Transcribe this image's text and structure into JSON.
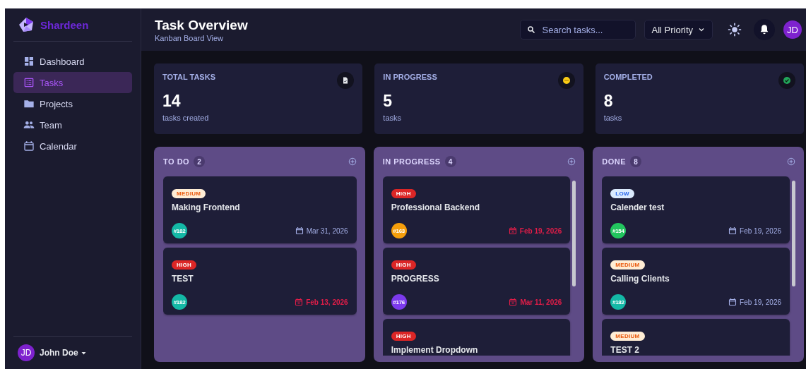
{
  "sidebar": {
    "brand": "Shardeen",
    "items": [
      {
        "label": "Dashboard",
        "selected": false
      },
      {
        "label": "Tasks",
        "selected": true
      },
      {
        "label": "Projects",
        "selected": false
      },
      {
        "label": "Team",
        "selected": false
      },
      {
        "label": "Calendar",
        "selected": false
      }
    ],
    "user": {
      "initials": "JD",
      "name": "John Doe"
    }
  },
  "header": {
    "title": "Task Overview",
    "subtitle": "Kanban Board View",
    "search": {
      "placeholder": "Search tasks..."
    },
    "filter": "All Priority",
    "avatar": "JD"
  },
  "stats": [
    {
      "kind": "total",
      "label": "TOTAL TASKS",
      "value": "14",
      "caption": "tasks created"
    },
    {
      "kind": "progress",
      "label": "IN PROGRESS",
      "value": "5",
      "caption": "tasks"
    },
    {
      "kind": "completed",
      "label": "COMPLETED",
      "value": "8",
      "caption": "tasks"
    }
  ],
  "columns": [
    {
      "title": "TO DO",
      "count": "2",
      "cards": [
        {
          "priority": "MEDIUM",
          "kind": "medium",
          "title": "Making Frontend",
          "id": "#182",
          "color": "#14b8a6",
          "date": "Mar 31, 2026",
          "overdue": false
        },
        {
          "priority": "HIGH",
          "kind": "high",
          "title": "TEST",
          "id": "#182",
          "color": "#14b8a6",
          "date": "Feb 13, 2026",
          "overdue": true
        }
      ]
    },
    {
      "title": "IN PROGRESS",
      "count": "4",
      "cards": [
        {
          "priority": "HIGH",
          "kind": "high",
          "title": "Professional Backend",
          "id": "#163",
          "color": "#f59e0b",
          "date": "Feb 19, 2026",
          "overdue": true
        },
        {
          "priority": "HIGH",
          "kind": "high",
          "title": "PROGRESS",
          "id": "#176",
          "color": "#7c3aed",
          "date": "Mar 11, 2026",
          "overdue": true
        },
        {
          "priority": "HIGH",
          "kind": "high",
          "title": "Implement Dropdown"
        }
      ]
    },
    {
      "title": "DONE",
      "count": "8",
      "cards": [
        {
          "priority": "LOW",
          "kind": "low",
          "title": "Calender test",
          "id": "#154",
          "color": "#22c55e",
          "date": "Feb 19, 2026",
          "overdue": false
        },
        {
          "priority": "MEDIUM",
          "kind": "medium",
          "title": "Calling Clients",
          "id": "#182",
          "color": "#14b8a6",
          "date": "Feb 19, 2026",
          "overdue": false
        },
        {
          "priority": "MEDIUM",
          "kind": "medium",
          "title": "TEST 2"
        }
      ]
    }
  ]
}
